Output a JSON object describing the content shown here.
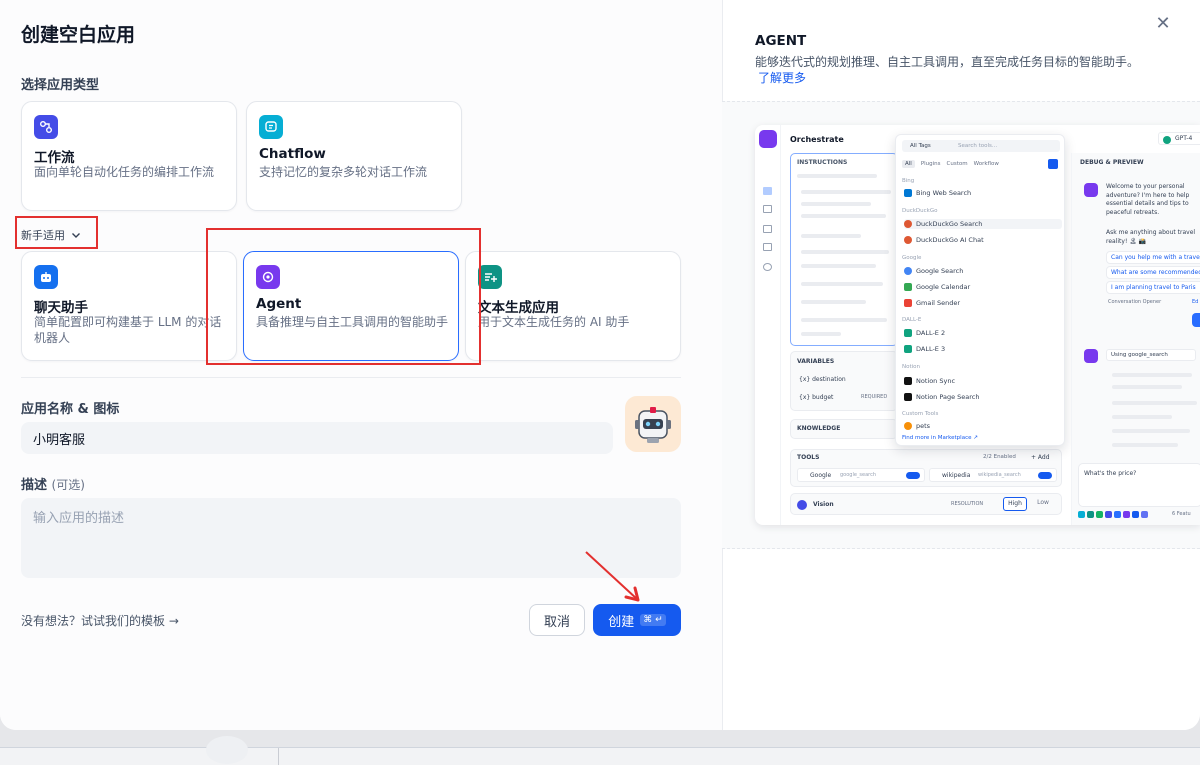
{
  "dialog": {
    "title": "创建空白应用",
    "section_type_label": "选择应用类型",
    "beginner_label": "新手适用",
    "cards_top": [
      {
        "title": "工作流",
        "desc": "面向单轮自动化任务的编排工作流",
        "icon": "workflow-icon",
        "color": "#444ce7"
      },
      {
        "title": "Chatflow",
        "desc": "支持记忆的复杂多轮对话工作流",
        "icon": "chatflow-icon",
        "color": "#06aed4"
      }
    ],
    "cards_bottom": [
      {
        "title": "聊天助手",
        "desc": "简单配置即可构建基于 LLM 的对话机器人",
        "icon": "chatbot-icon",
        "color": "#1570ef"
      },
      {
        "title": "Agent",
        "desc": "具备推理与自主工具调用的智能助手",
        "icon": "agent-icon",
        "color": "#7839ee"
      },
      {
        "title": "文本生成应用",
        "desc": "用于文本生成任务的 AI 助手",
        "icon": "text-gen-icon",
        "color": "#0e9384"
      }
    ],
    "name_label": "应用名称 & 图标",
    "name_value": "小明客服",
    "desc_label": "描述",
    "desc_optional": "(可选)",
    "desc_placeholder": "输入应用的描述",
    "templates_link": "没有想法？试试我们的模板 →",
    "cancel": "取消",
    "create": "创建",
    "create_kbd": "⌘ ↵"
  },
  "preview": {
    "title": "AGENT",
    "desc": "能够迭代式的规划推理、自主工具调用，直至完成任务目标的智能助手。",
    "learn_more": "了解更多",
    "mock": {
      "orchestrate": "Orchestrate",
      "model": "GPT-4",
      "instructions": "INSTRUCTIONS",
      "debug": "DEBUG & PREVIEW",
      "variables": "VARIABLES",
      "var1": "{x} destination",
      "var2": "{x} budget",
      "required": "REQUIRED",
      "knowledge": "KNOWLEDGE",
      "tools": "TOOLS",
      "tools_enabled": "2/2 Enabled",
      "add": "+ Add",
      "tool1": "Google",
      "tool1_id": "google_search",
      "tool2": "wikipedia",
      "tool2_id": "wikipedia_search",
      "vision": "Vision",
      "resolution": "RESOLUTION",
      "high": "High",
      "low": "Low",
      "all_tags": "All Tags",
      "search_tools": "Search tools...",
      "tabs": [
        "All",
        "Plugins",
        "Custom",
        "Workflow"
      ],
      "groups": {
        "bing": "Bing",
        "ddg": "DuckDuckGo",
        "google": "Google",
        "dalle": "DALL-E",
        "notion": "Notion",
        "custom": "Custom Tools"
      },
      "items": {
        "bing_web": "Bing Web Search",
        "ddg_search": "DuckDuckGo Search",
        "ddg_chat": "DuckDuckGo AI Chat",
        "google_search": "Google Search",
        "google_cal": "Google Calendar",
        "gmail": "Gmail Sender",
        "dalle2": "DALL-E 2",
        "dalle3": "DALL-E 3",
        "notion_sync": "Notion Sync",
        "notion_page": "Notion Page Search",
        "pets": "pets"
      },
      "find_more": "Find more in Marketplace ↗",
      "welcome": "Welcome to your personal adventure? I'm here to help essential details and tips to peaceful retreats.",
      "ask": "Ask me anything about travel reality! 🏝 📸",
      "s1": "Can you help me with a travel",
      "s2": "What are some recommended",
      "s3": "I am planning travel to Paris",
      "opener": "Conversation Opener",
      "edit": "Ed",
      "using": "Using",
      "using_tool": "google_search",
      "question": "What's the price?",
      "features": "6 Featu"
    }
  }
}
